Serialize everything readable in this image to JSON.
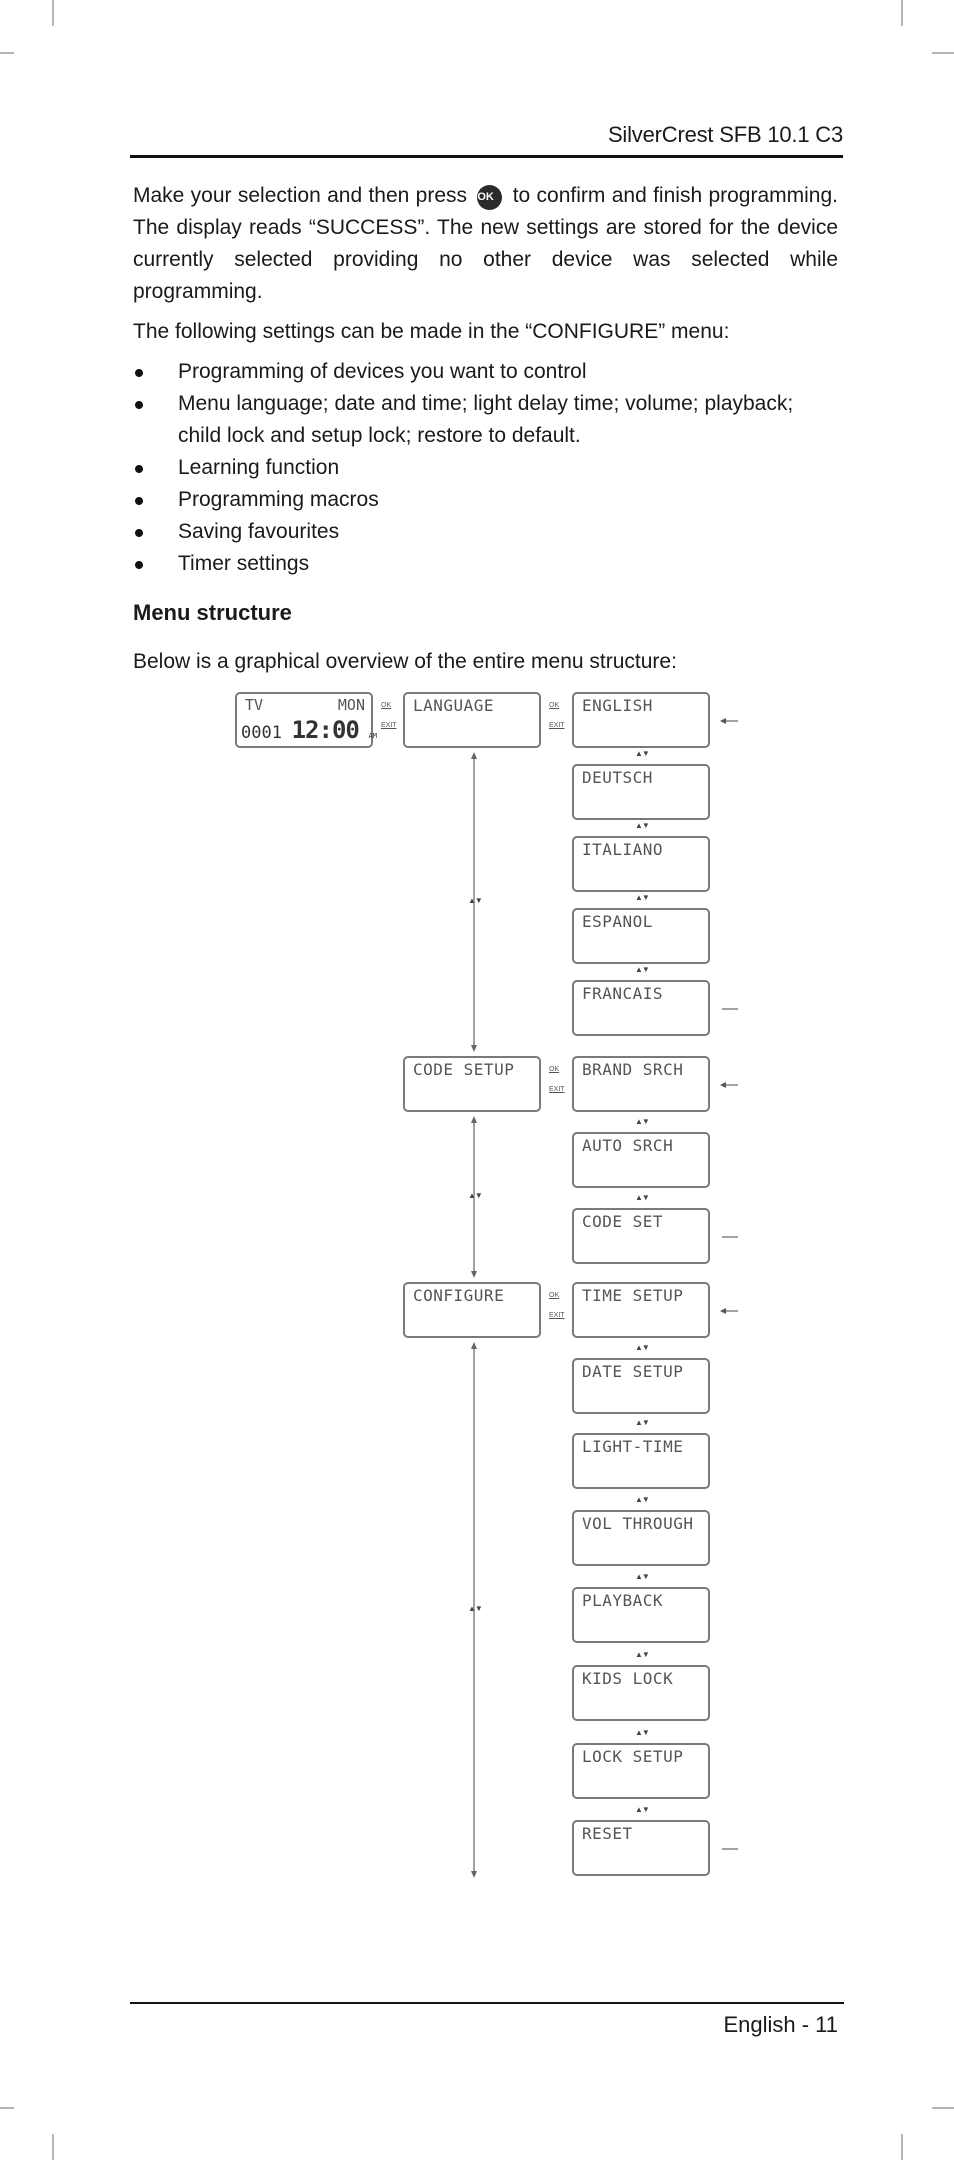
{
  "header": {
    "title": "SilverCrest SFB 10.1 C3"
  },
  "body": {
    "para1_before_icon": "Make your selection and then press",
    "ok_icon_label": "OK",
    "para1_after_icon": "to confirm and finish programming. The display reads “SUCCESS”. The new settings are stored for the device currently selected providing no other device was selected while programming.",
    "para2": "The following settings can be made in the “CONFIGURE” menu:",
    "bullets": [
      "Programming of devices you want to control",
      "Menu language; date and time; light delay time; volume; playback; child lock and setup lock; restore to default.",
      "Learning function",
      "Programming macros",
      "Saving favourites",
      "Timer settings"
    ],
    "section_heading": "Menu structure",
    "intro": "Below is a graphical overview of the entire menu structure:"
  },
  "diagram": {
    "home_display": {
      "source": "TV",
      "day": "MON",
      "code": "0001",
      "time": "12:00",
      "ampm": "AM"
    },
    "nav_labels": {
      "ok": "OK",
      "exit": "EXIT",
      "updown": "▲▼"
    },
    "main_menu": [
      "LANGUAGE",
      "CODE SETUP",
      "CONFIGURE"
    ],
    "submenus": {
      "language": [
        "ENGLISH",
        "DEUTSCH",
        "ITALIANO",
        "ESPANOL",
        "FRANCAIS"
      ],
      "code_setup": [
        "BRAND SRCH",
        "AUTO SRCH",
        "CODE SET"
      ],
      "configure": [
        "TIME SETUP",
        "DATE SETUP",
        "LIGHT-TIME",
        "VOL THROUGH",
        "PLAYBACK",
        "KIDS LOCK",
        "LOCK SETUP",
        "RESET"
      ]
    }
  },
  "footer": {
    "page_label": "English - 11"
  }
}
